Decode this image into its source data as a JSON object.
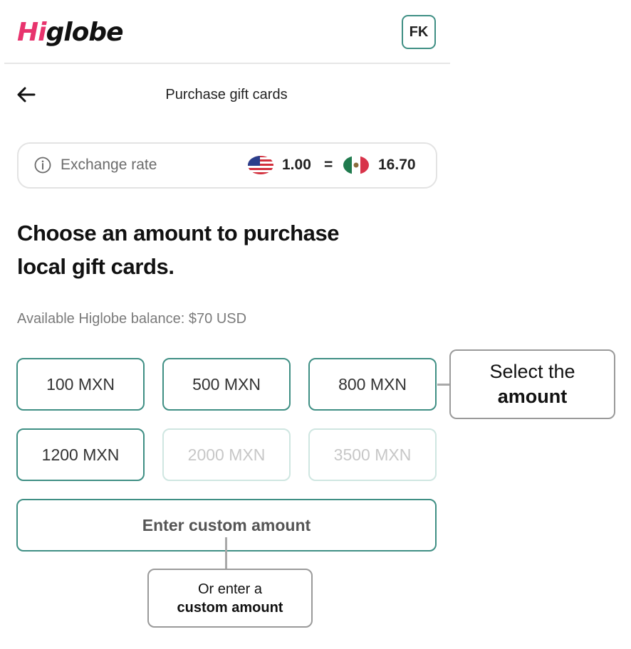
{
  "header": {
    "logo_hi": "Hi",
    "logo_rest": "globe",
    "avatar_initials": "FK"
  },
  "page": {
    "title": "Purchase gift cards"
  },
  "exchange": {
    "label": "Exchange rate",
    "from_value": "1.00",
    "equals": "=",
    "to_value": "16.70"
  },
  "content": {
    "heading_line1": "Choose an amount to purchase",
    "heading_line2": "local gift cards.",
    "balance": "Available Higlobe balance: $70 USD"
  },
  "amounts": [
    {
      "label": "100 MXN",
      "enabled": true
    },
    {
      "label": "500 MXN",
      "enabled": true
    },
    {
      "label": "800 MXN",
      "enabled": true
    },
    {
      "label": "1200 MXN",
      "enabled": true
    },
    {
      "label": "2000 MXN",
      "enabled": false
    },
    {
      "label": "3500 MXN",
      "enabled": false
    }
  ],
  "custom_amount_label": "Enter custom amount",
  "annotations": {
    "select_line1": "Select the",
    "select_line2": "amount",
    "custom_line1": "Or enter a",
    "custom_line2": "custom amount"
  },
  "colors": {
    "brand_pink": "#e8336d",
    "accent_teal": "#3f8f84",
    "disabled_border": "#cfe6e1"
  }
}
